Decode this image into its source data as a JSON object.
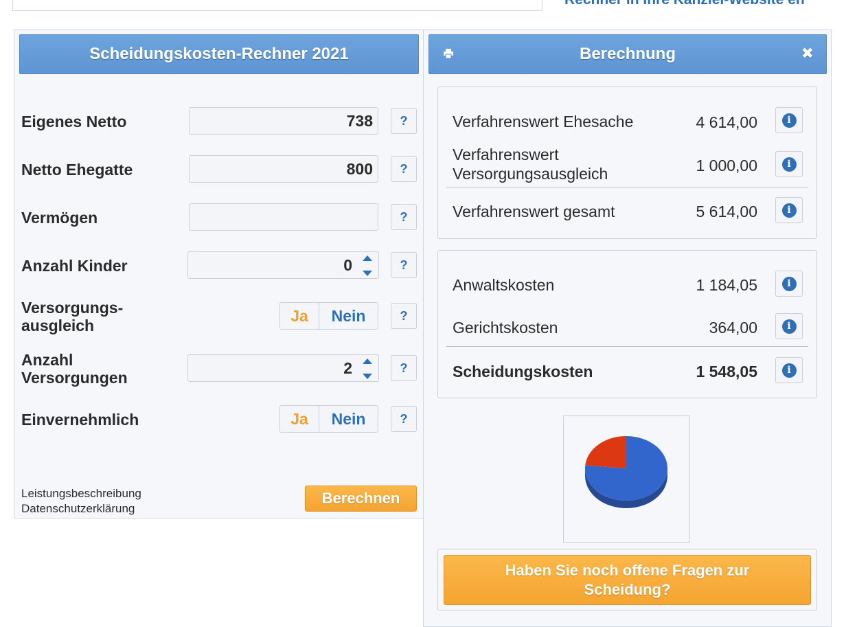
{
  "top": {
    "embed_link": "Rechner in Ihre Kanzlei-Website en"
  },
  "left": {
    "title": "Scheidungskosten-Rechner 2021",
    "help_label": "?",
    "fields": {
      "eigenes_netto": {
        "label": "Eigenes Netto",
        "value": "738"
      },
      "netto_ehegatte": {
        "label": "Netto Ehegatte",
        "value": "800"
      },
      "vermoegen": {
        "label": "Vermögen",
        "value": ""
      },
      "anzahl_kinder": {
        "label": "Anzahl Kinder",
        "value": "0"
      },
      "versorgungsausgleich": {
        "label_line1": "Versorgungs-",
        "label_line2": "ausgleich",
        "ja": "Ja",
        "nein": "Nein"
      },
      "anzahl_versorgungen": {
        "label_line1": "Anzahl",
        "label_line2": "Versorgungen",
        "value": "2"
      },
      "einvernehmlich": {
        "label": "Einvernehmlich",
        "ja": "Ja",
        "nein": "Nein"
      }
    },
    "links": {
      "leistung": "Leistungsbeschreibung",
      "datenschutz": "Datenschutzerklärung"
    },
    "calc_button": "Berechnen"
  },
  "right": {
    "title": "Berechnung",
    "print_icon": "print-icon",
    "close_icon": "close-icon",
    "values": {
      "ehesache": {
        "label": "Verfahrenswert Ehesache",
        "value": "4 614,00"
      },
      "versorgung": {
        "label_line1": "Verfahrenswert",
        "label_line2": "Versorgungsausgleich",
        "value": "1 000,00"
      },
      "gesamt": {
        "label": "Verfahrenswert gesamt",
        "value": "5 614,00"
      }
    },
    "costs": {
      "anwalt": {
        "label": "Anwaltskosten",
        "value": "1 184,05"
      },
      "gericht": {
        "label": "Gerichtskosten",
        "value": "364,00"
      },
      "scheidung": {
        "label": "Scheidungskosten",
        "value": "1 548,05"
      }
    },
    "pie": {
      "slices": [
        {
          "value": 1184.05,
          "color": "#3366cc"
        },
        {
          "value": 364.0,
          "color": "#dc3912"
        }
      ]
    },
    "cta": "Haben Sie noch offene Fragen zur Scheidung?"
  },
  "colors": {
    "header_blue": "#6ea4dd",
    "accent_orange": "#f4a431",
    "link_blue": "#2a6ebb"
  }
}
